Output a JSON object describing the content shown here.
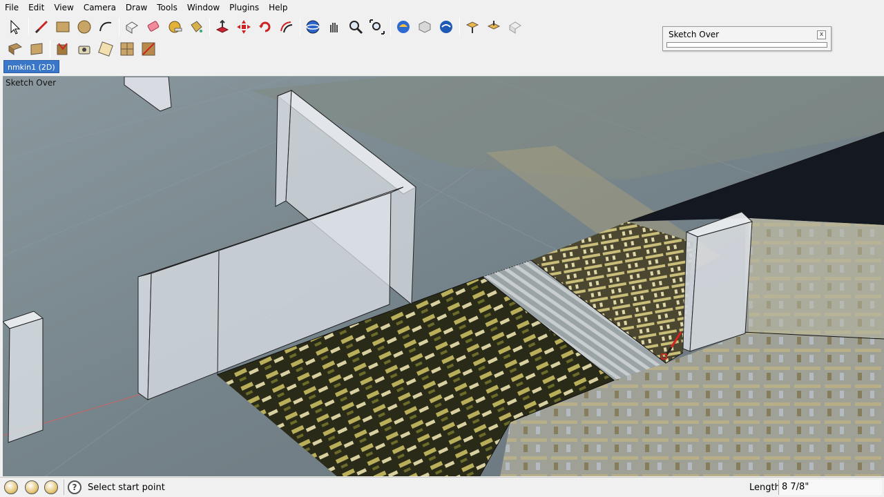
{
  "menu": [
    "File",
    "Edit",
    "View",
    "Camera",
    "Draw",
    "Tools",
    "Window",
    "Plugins",
    "Help"
  ],
  "toolbar1": [
    {
      "name": "select-icon"
    },
    {
      "sep": true
    },
    {
      "name": "pencil-line-icon"
    },
    {
      "name": "rectangle-icon"
    },
    {
      "name": "circle-icon"
    },
    {
      "name": "arc-icon"
    },
    {
      "sep": true
    },
    {
      "name": "make-component-icon"
    },
    {
      "name": "eraser-icon"
    },
    {
      "name": "tape-measure-icon"
    },
    {
      "name": "paint-bucket-icon"
    },
    {
      "sep": true
    },
    {
      "name": "push-pull-icon"
    },
    {
      "name": "move-icon"
    },
    {
      "name": "rotate-icon"
    },
    {
      "name": "offset-icon"
    },
    {
      "sep": true
    },
    {
      "name": "orbit-icon"
    },
    {
      "name": "pan-icon"
    },
    {
      "name": "zoom-icon"
    },
    {
      "name": "zoom-extents-icon"
    },
    {
      "sep": true
    },
    {
      "name": "get-models-icon"
    },
    {
      "name": "share-model-icon"
    },
    {
      "name": "google-earth-icon"
    },
    {
      "sep": true
    },
    {
      "name": "get-component-icon"
    },
    {
      "name": "share-component-icon"
    },
    {
      "name": "extension-icon"
    }
  ],
  "toolbar2": [
    {
      "name": "position-texture-icon"
    },
    {
      "name": "texture-tools-icon"
    },
    {
      "sep": true
    },
    {
      "name": "fix-texture-icon"
    },
    {
      "name": "camera-match-icon"
    },
    {
      "name": "unwrap-icon"
    },
    {
      "name": "grid-texture-icon"
    },
    {
      "name": "clear-texture-icon"
    }
  ],
  "scene_tab": {
    "label": "nmkin1 (2D)"
  },
  "dialog": {
    "title": "Sketch Over",
    "close": "x"
  },
  "viewport": {
    "label": "Sketch Over"
  },
  "status": {
    "text": "Select start point",
    "help_glyph": "?",
    "length_label": "Length",
    "length_value": "8 7/8\""
  },
  "colors": {
    "accent": "#3a77c9",
    "wall": "#d8dde4",
    "floor": "#6f7a80"
  }
}
